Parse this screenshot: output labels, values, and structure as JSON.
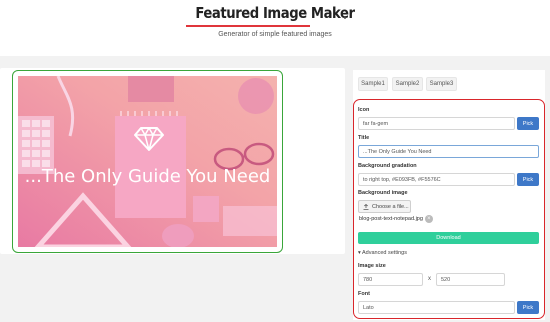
{
  "header": {
    "title": "Featured Image Maker",
    "subtitle": "Generator of simple featured images"
  },
  "preview": {
    "text": "...The Only Guide You Need",
    "icon": "gem-icon",
    "gradient_colors": [
      "#E87AA3",
      "#F5B2AE"
    ]
  },
  "tabs": [
    "Sample1",
    "Sample2",
    "Sample3"
  ],
  "form": {
    "icon_label": "Icon",
    "icon_value": "far fa-gem",
    "title_label": "Title",
    "title_value": "...The Only Guide You Need",
    "gradient_label": "Background gradation",
    "gradient_value": "to right top, #E093FB, #F5576C",
    "bg_image_label": "Background image",
    "choose_file": "Choose a file...",
    "file_name": "blog-post-text-notepad.jpg",
    "download": "Download",
    "advanced": "Advanced settings",
    "image_size_label": "Image size",
    "width": "780",
    "height": "520",
    "times": "x",
    "font_label": "Font",
    "font_value": "Lato",
    "pick": "Pick"
  },
  "colors": {
    "accent_red": "#d9262b",
    "accent_green": "#3aa63a",
    "pick_blue": "#3e78c8",
    "download_green": "#2fcf9b"
  }
}
